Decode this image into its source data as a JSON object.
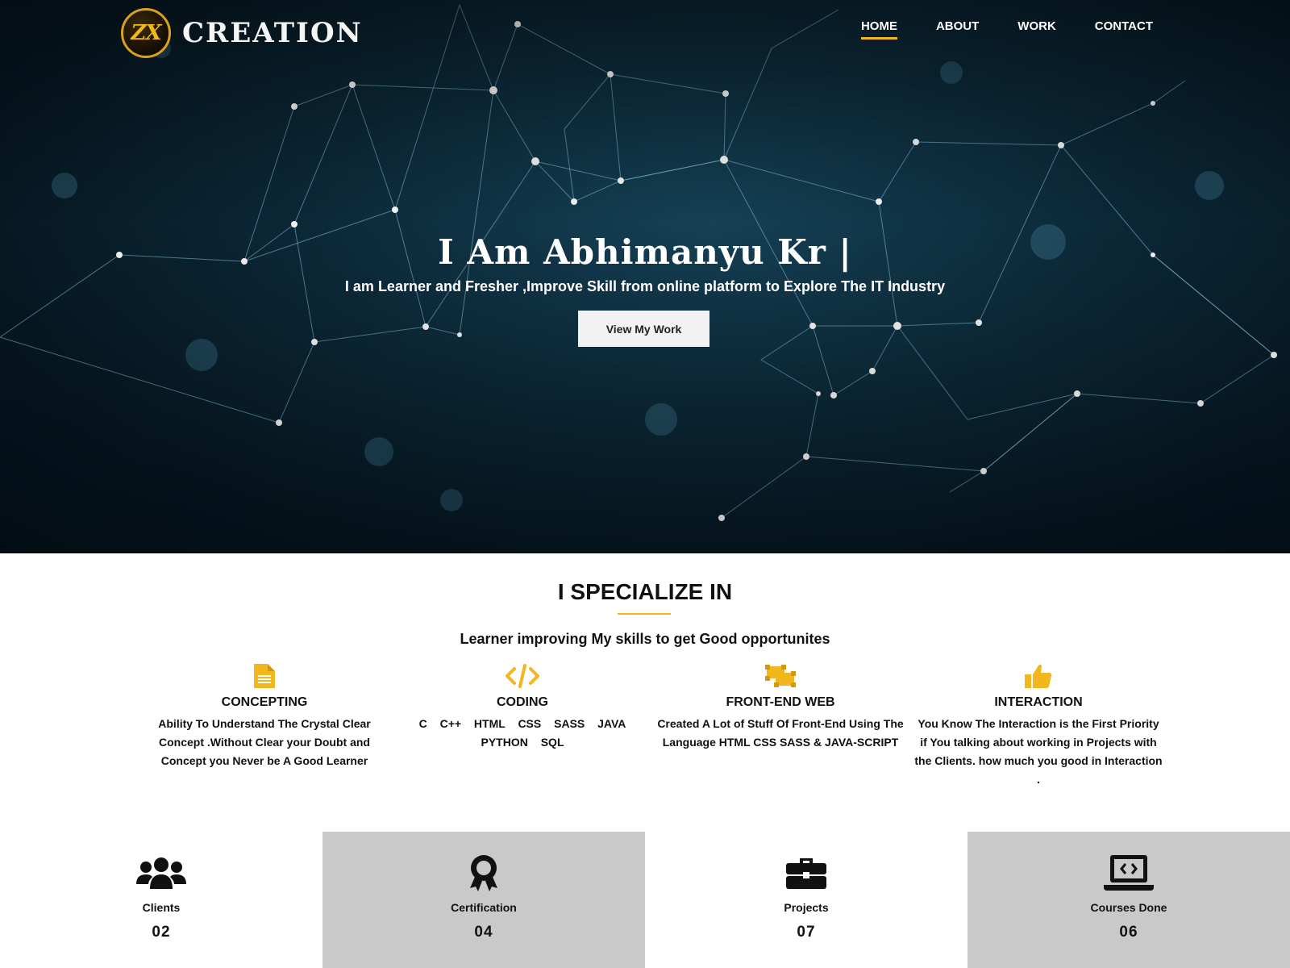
{
  "brand": {
    "badge": "ZX",
    "name": "CREATION"
  },
  "nav": {
    "items": [
      {
        "label": "HOME",
        "active": true
      },
      {
        "label": "ABOUT",
        "active": false
      },
      {
        "label": "WORK",
        "active": false
      },
      {
        "label": "CONTACT",
        "active": false
      }
    ]
  },
  "hero": {
    "title": "I Am Abhimanyu Kr |",
    "subtitle": "I am Learner and Fresher ,Improve Skill from online platform to Explore The IT Industry",
    "button": "View My Work"
  },
  "specialize": {
    "title": "I SPECIALIZE IN",
    "subtitle": "Learner improving My skills to get Good opportunites",
    "features": [
      {
        "icon": "document-icon",
        "name": "CONCEPTING",
        "desc": "Ability To Understand The Crystal Clear Concept .Without Clear your Doubt and Concept you Never be A Good Learner"
      },
      {
        "icon": "code-icon",
        "name": "CODING",
        "desc": "C C++ HTML CSS SASS JAVA PYTHON SQL"
      },
      {
        "icon": "object-ungroup-icon",
        "name": "FRONT-END WEB",
        "desc": "Created A Lot of Stuff Of Front-End Using The Language HTML CSS SASS & JAVA-SCRIPT"
      },
      {
        "icon": "thumbs-up-icon",
        "name": "INTERACTION",
        "desc": "You Know The Interaction is the First Priority if You talking about working in Projects with the Clients. how much you good in Interaction ."
      }
    ]
  },
  "stats": [
    {
      "icon": "users-icon",
      "label": "Clients",
      "value": "02"
    },
    {
      "icon": "award-icon",
      "label": "Certification",
      "value": "04"
    },
    {
      "icon": "briefcase-icon",
      "label": "Projects",
      "value": "07"
    },
    {
      "icon": "laptop-code-icon",
      "label": "Courses Done",
      "value": "06"
    }
  ],
  "colors": {
    "accent": "#f2b71f",
    "hero_bg": "#0c2a3a",
    "stat_grey": "#c9c9c9"
  }
}
